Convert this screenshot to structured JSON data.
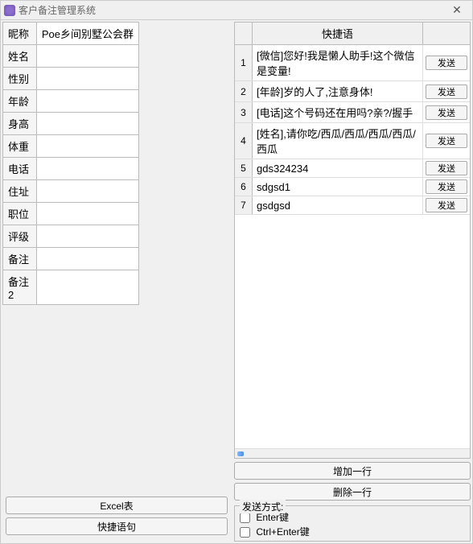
{
  "window": {
    "title": "客户备注管理系统"
  },
  "form": {
    "rows": [
      {
        "label": "昵称",
        "value": "Poe乡间别墅公会群"
      },
      {
        "label": "姓名",
        "value": ""
      },
      {
        "label": "性别",
        "value": ""
      },
      {
        "label": "年龄",
        "value": ""
      },
      {
        "label": "身高",
        "value": ""
      },
      {
        "label": "体重",
        "value": ""
      },
      {
        "label": "电话",
        "value": ""
      },
      {
        "label": "住址",
        "value": ""
      },
      {
        "label": "职位",
        "value": ""
      },
      {
        "label": "评级",
        "value": ""
      },
      {
        "label": "备注",
        "value": ""
      },
      {
        "label": "备注2",
        "value": ""
      }
    ]
  },
  "left_buttons": {
    "excel": "Excel表",
    "quick_phrase": "快捷语句"
  },
  "quick_table": {
    "header": "快捷语",
    "send_label": "发送",
    "rows": [
      {
        "num": "1",
        "text": "[微信]您好!我是懒人助手!这个微信是变量!"
      },
      {
        "num": "2",
        "text": "[年龄]岁的人了,注意身体!"
      },
      {
        "num": "3",
        "text": "[电话]这个号码还在用吗?亲?/握手"
      },
      {
        "num": "4",
        "text": "[姓名],请你吃/西瓜/西瓜/西瓜/西瓜/西瓜"
      },
      {
        "num": "5",
        "text": "gds324234"
      },
      {
        "num": "6",
        "text": "sdgsd1"
      },
      {
        "num": "7",
        "text": "gsdgsd"
      }
    ]
  },
  "row_buttons": {
    "add": "增加一行",
    "delete": "删除一行"
  },
  "send_mode": {
    "title": "发送方式:",
    "enter": "Enter键",
    "ctrl_enter": "Ctrl+Enter键"
  }
}
